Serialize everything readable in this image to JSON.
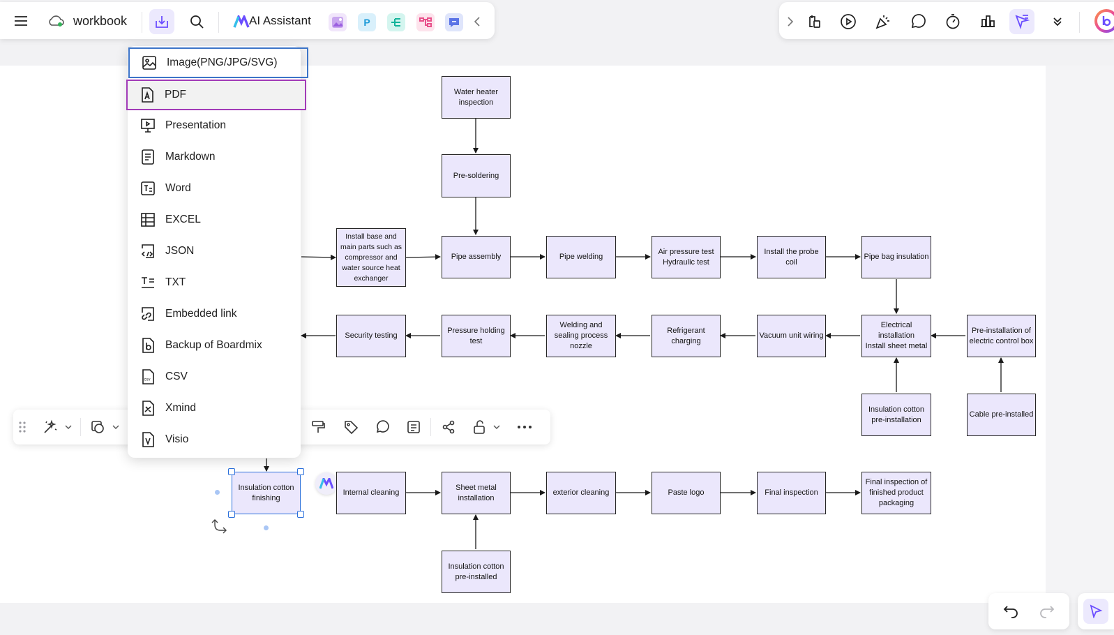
{
  "toolbar": {
    "workbook_label": "workbook",
    "ai_assistant_label": "AI Assistant"
  },
  "export_menu": {
    "items": [
      {
        "label": "Image(PNG/JPG/SVG)",
        "icon": "image-icon"
      },
      {
        "label": "PDF",
        "icon": "pdf-icon"
      },
      {
        "label": "Presentation",
        "icon": "presentation-icon"
      },
      {
        "label": "Markdown",
        "icon": "markdown-icon"
      },
      {
        "label": "Word",
        "icon": "word-icon"
      },
      {
        "label": "EXCEL",
        "icon": "excel-icon"
      },
      {
        "label": "JSON",
        "icon": "json-icon"
      },
      {
        "label": "TXT",
        "icon": "txt-icon"
      },
      {
        "label": "Embedded link",
        "icon": "embedded-link-icon"
      },
      {
        "label": "Backup of Boardmix",
        "icon": "boardmix-icon"
      },
      {
        "label": "CSV",
        "icon": "csv-icon"
      },
      {
        "label": "Xmind",
        "icon": "xmind-icon"
      },
      {
        "label": "Visio",
        "icon": "visio-icon"
      }
    ]
  },
  "flowchart": {
    "nodes": [
      {
        "id": "water_heater",
        "label": "Water heater inspection"
      },
      {
        "id": "pre_soldering",
        "label": "Pre-soldering"
      },
      {
        "id": "install_base",
        "label": "Install base and main parts such as compressor and water source heat exchanger"
      },
      {
        "id": "pipe_assembly",
        "label": "Pipe assembly"
      },
      {
        "id": "pipe_welding",
        "label": "Pipe welding"
      },
      {
        "id": "air_pressure",
        "label": "Air pressure test\nHydraulic test"
      },
      {
        "id": "probe_coil",
        "label": "Install the probe coil"
      },
      {
        "id": "pipe_bag",
        "label": "Pipe bag insulation"
      },
      {
        "id": "security",
        "label": "Security testing"
      },
      {
        "id": "pressure_holding",
        "label": "Pressure holding test"
      },
      {
        "id": "welding_sealing",
        "label": "Welding and sealing process nozzle"
      },
      {
        "id": "refrigerant",
        "label": "Refrigerant charging"
      },
      {
        "id": "vacuum",
        "label": "Vacuum unit wiring"
      },
      {
        "id": "electrical",
        "label": "Electrical installation\nInstall sheet metal"
      },
      {
        "id": "pre_control_box",
        "label": "Pre-installation of electric control box"
      },
      {
        "id": "insulation_pre",
        "label": "Insulation cotton pre-installation"
      },
      {
        "id": "cable_pre",
        "label": "Cable pre-installed"
      },
      {
        "id": "insulation_finish",
        "label": "Insulation cotton finishing"
      },
      {
        "id": "internal_clean",
        "label": "Internal cleaning"
      },
      {
        "id": "sheet_metal",
        "label": "Sheet metal installation"
      },
      {
        "id": "exterior_clean",
        "label": "exterior cleaning"
      },
      {
        "id": "paste_logo",
        "label": "Paste logo"
      },
      {
        "id": "final_inspection",
        "label": "Final inspection"
      },
      {
        "id": "final_packaging",
        "label": "Final inspection of finished product packaging"
      },
      {
        "id": "insulation_pre_installed",
        "label": "Insulation cotton pre-installed"
      }
    ]
  },
  "colors": {
    "node_fill": "#ebe7fc",
    "accent": "#6b4eff",
    "selection": "#2a6fdb"
  }
}
